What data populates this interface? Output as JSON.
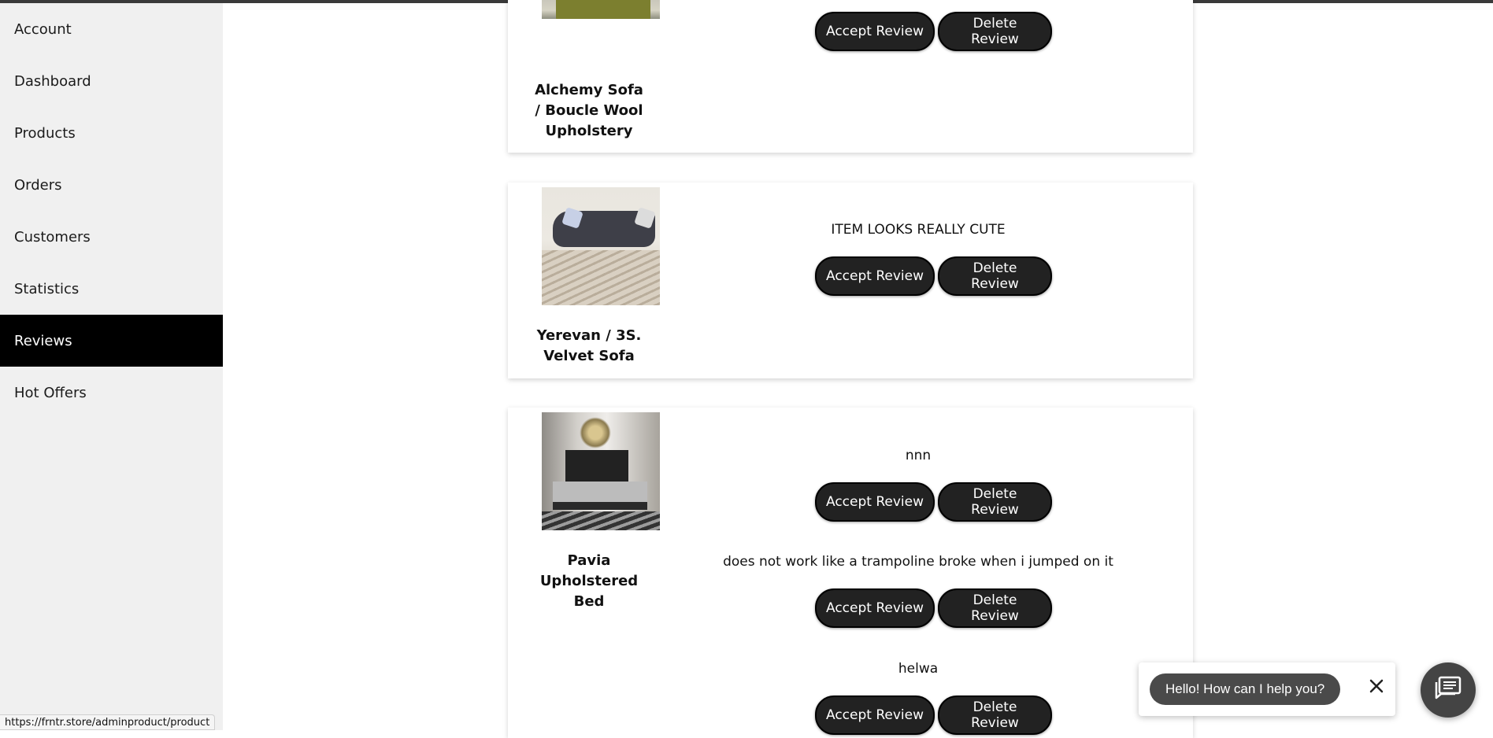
{
  "sidebar": {
    "items": [
      {
        "label": "Account"
      },
      {
        "label": "Dashboard"
      },
      {
        "label": "Products"
      },
      {
        "label": "Orders"
      },
      {
        "label": "Customers"
      },
      {
        "label": "Statistics"
      },
      {
        "label": "Reviews"
      },
      {
        "label": "Hot Offers"
      }
    ],
    "active": "Reviews"
  },
  "products": [
    {
      "name": "Alchemy Sofa / Boucle Wool Upholstery",
      "name_lines": [
        "Alchemy Sofa",
        "/ Boucle Wool",
        "Upholstery"
      ],
      "image_icon": "green-sofa-image",
      "reviews": [
        {
          "text": "",
          "accept_label": "Accept Review",
          "delete_label": "Delete Review"
        }
      ]
    },
    {
      "name": "Yerevan / 3S. Velvet Sofa",
      "name_lines": [
        "Yerevan / 3S.",
        "Velvet Sofa"
      ],
      "image_icon": "grey-velvet-sofa-image",
      "reviews": [
        {
          "text": "ITEM LOOKS REALLY CUTE",
          "accept_label": "Accept Review",
          "delete_label": "Delete Review"
        }
      ]
    },
    {
      "name": "Pavia Upholstered Bed",
      "name_lines": [
        "Pavia",
        "Upholstered",
        "Bed"
      ],
      "image_icon": "bed-image",
      "reviews": [
        {
          "text": "nnn",
          "accept_label": "Accept Review",
          "delete_label": "Delete Review"
        },
        {
          "text": "does not work like a trampoline broke when i jumped on it",
          "accept_label": "Accept Review",
          "delete_label": "Delete Review"
        },
        {
          "text": "helwa",
          "accept_label": "Accept Review",
          "delete_label": "Delete Review"
        }
      ]
    }
  ],
  "status_bar": {
    "url": "https://frntr.store/adminproduct/product"
  },
  "chat": {
    "greeting": "Hello! How can I help you?",
    "close_icon": "close-icon",
    "launcher_icon": "chat-icon"
  },
  "colors": {
    "active_nav": "#000000",
    "sidebar_bg": "#f0f0f0",
    "button_bg": "#222222",
    "chat_bg": "#4a4a4a"
  }
}
